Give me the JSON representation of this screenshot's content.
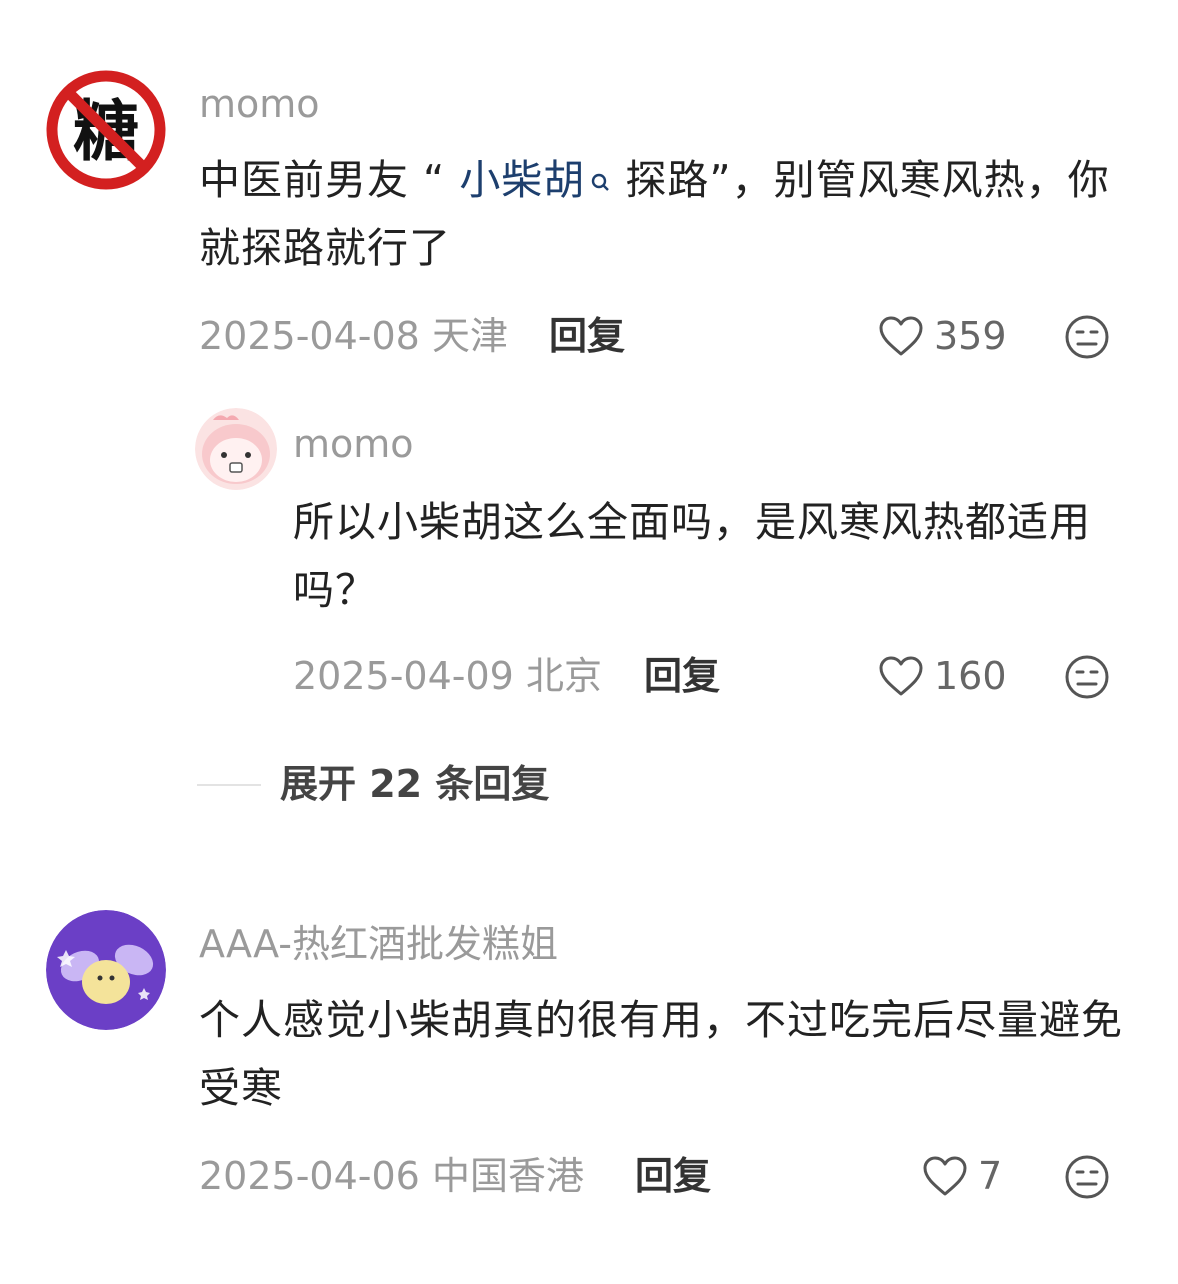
{
  "comments": [
    {
      "username": "momo",
      "avatar_char": "糖",
      "text_before": "中医前男友 “ ",
      "highlight": "小柴胡",
      "text_after": " 探路”，别管风寒风热，你就探路就行了",
      "date": "2025-04-08",
      "location": "天津",
      "reply_label": "回复",
      "likes": "359"
    },
    {
      "username": "momo",
      "text": "所以小柴胡这么全面吗，是风寒风热都适用吗？",
      "date": "2025-04-09",
      "location": "北京",
      "reply_label": "回复",
      "likes": "160"
    },
    {
      "username": "AAA-热红酒批发糕姐",
      "text": "个人感觉小柴胡真的很有用，不过吃完后尽量避免受寒",
      "date": "2025-04-06",
      "location": "中国香港",
      "reply_label": "回复",
      "likes": "7"
    }
  ],
  "expand_label": "展开 22 条回复",
  "icons": {
    "like": "heart-outline-icon",
    "reaction": "neutral-face-icon",
    "search_hint": "search-icon"
  },
  "colors": {
    "meta": "#9a9a9a",
    "highlight": "#1d3f6e",
    "avatar_no_sugar_red": "#d32020",
    "avatar3_purple": "#6b3fc6"
  }
}
